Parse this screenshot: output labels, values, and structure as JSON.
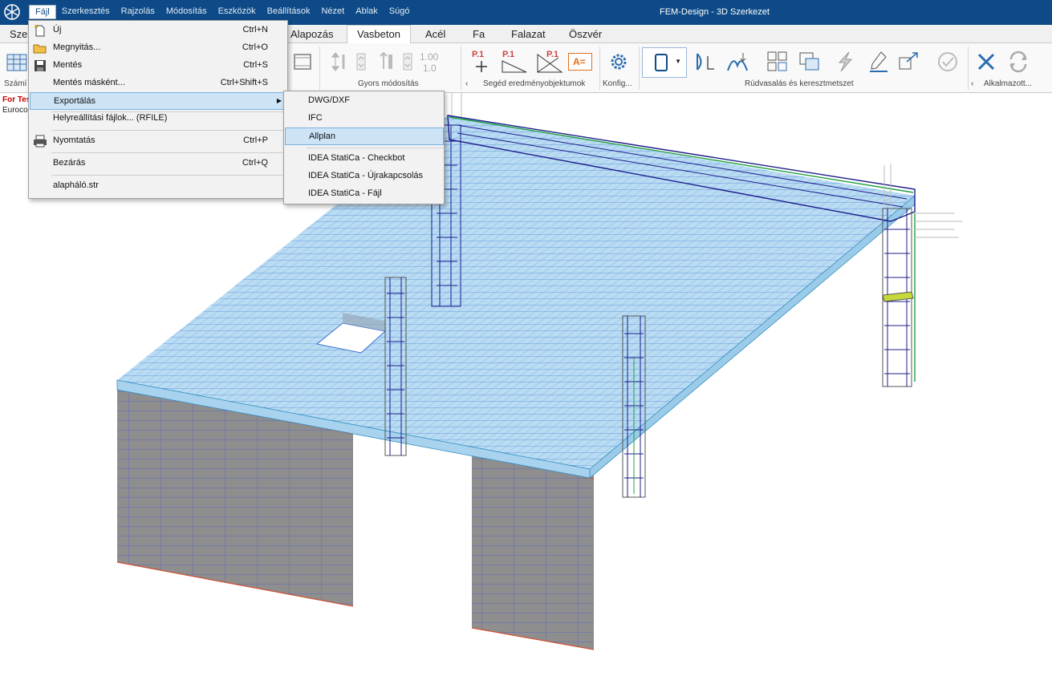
{
  "app": {
    "title": "FEM-Design - 3D Szerkezet"
  },
  "menubar": [
    "Fájl",
    "Szerkesztés",
    "Rajzolás",
    "Módosítás",
    "Eszközök",
    "Beállítások",
    "Nézet",
    "Ablak",
    "Súgó"
  ],
  "tabs": {
    "partial": "Sze",
    "items": [
      "Alapozás",
      "Vasbeton",
      "Acél",
      "Fa",
      "Falazat",
      "Öszvér"
    ],
    "selected": "Vasbeton"
  },
  "ribbon": {
    "groups": [
      "Gyors módosítás",
      "Segéd eredményobjektumok",
      "Konfig...",
      "Rúdvasalás és keresztmetszet",
      "Alkalmazott..."
    ],
    "left_label": "Számí",
    "values": [
      "1.00",
      "1.0"
    ],
    "p_labels": [
      "P.1",
      "P.1",
      "P.1"
    ],
    "a_label": "A="
  },
  "side": {
    "line1": "For Tes",
    "line2": "Euroco"
  },
  "file_menu": {
    "items": [
      {
        "label": "Új",
        "shortcut": "Ctrl+N",
        "icon": "new-file-icon"
      },
      {
        "label": "Megnyitás...",
        "shortcut": "Ctrl+O",
        "icon": "open-folder-icon"
      },
      {
        "label": "Mentés",
        "shortcut": "Ctrl+S",
        "icon": "save-icon"
      },
      {
        "label": "Mentés másként...",
        "shortcut": "Ctrl+Shift+S",
        "icon": ""
      },
      {
        "label": "Exportálás",
        "shortcut": "",
        "icon": ""
      },
      {
        "label": "Helyreállítási fájlok... (RFILE)",
        "shortcut": "",
        "icon": ""
      },
      {
        "label": "Nyomtatás",
        "shortcut": "Ctrl+P",
        "icon": "printer-icon"
      },
      {
        "label": "Bezárás",
        "shortcut": "Ctrl+Q",
        "icon": ""
      },
      {
        "label": "alapháló.str",
        "shortcut": "",
        "icon": ""
      }
    ]
  },
  "export_menu": {
    "items": [
      "DWG/DXF",
      "IFC",
      "Allplan",
      "IDEA StatiCa - Checkbot",
      "IDEA StatiCa - Újrakapcsolás",
      "IDEA StatiCa - Fájl"
    ],
    "highlighted": "Allplan"
  },
  "colors": {
    "title_bar": "#0d4a87",
    "slab": "#b9dcf2",
    "mesh": "#3a6fd0",
    "wall": "#8e8e8e",
    "rebar_dark": "#1c1c8c",
    "highlight": "#cde4f7"
  }
}
